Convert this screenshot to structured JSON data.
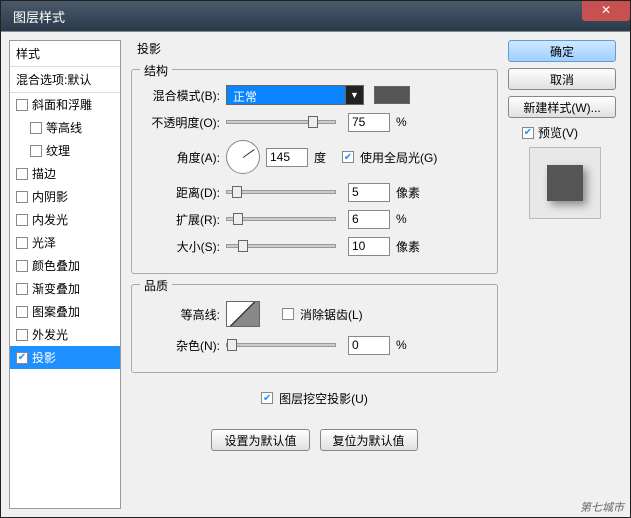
{
  "titlebar": {
    "title": "图层样式"
  },
  "left": {
    "headers": [
      "样式",
      "混合选项:默认"
    ],
    "items": [
      {
        "key": "bevel",
        "label": "斜面和浮雕",
        "checked": false,
        "indent": 0
      },
      {
        "key": "contour",
        "label": "等高线",
        "checked": false,
        "indent": 1
      },
      {
        "key": "texture",
        "label": "纹理",
        "checked": false,
        "indent": 1
      },
      {
        "key": "stroke",
        "label": "描边",
        "checked": false,
        "indent": 0
      },
      {
        "key": "innershadow",
        "label": "内阴影",
        "checked": false,
        "indent": 0
      },
      {
        "key": "innerglow",
        "label": "内发光",
        "checked": false,
        "indent": 0
      },
      {
        "key": "satin",
        "label": "光泽",
        "checked": false,
        "indent": 0
      },
      {
        "key": "coloroverlay",
        "label": "颜色叠加",
        "checked": false,
        "indent": 0
      },
      {
        "key": "gradientoverlay",
        "label": "渐变叠加",
        "checked": false,
        "indent": 0
      },
      {
        "key": "patternoverlay",
        "label": "图案叠加",
        "checked": false,
        "indent": 0
      },
      {
        "key": "outerglow",
        "label": "外发光",
        "checked": false,
        "indent": 0
      },
      {
        "key": "dropshadow",
        "label": "投影",
        "checked": true,
        "indent": 0,
        "selected": true
      }
    ]
  },
  "section_title": "投影",
  "structure": {
    "legend": "结构",
    "blend_label": "混合模式(B):",
    "blend_value": "正常",
    "opacity_label": "不透明度(O):",
    "opacity_value": "75",
    "angle_label": "角度(A):",
    "angle_value": "145",
    "angle_unit": "度",
    "global_label": "使用全局光(G)",
    "global_checked": true,
    "distance_label": "距离(D):",
    "distance_value": "5",
    "distance_unit": "像素",
    "spread_label": "扩展(R):",
    "spread_value": "6",
    "size_label": "大小(S):",
    "size_value": "10",
    "size_unit": "像素",
    "pct": "%"
  },
  "quality": {
    "legend": "品质",
    "contour_label": "等高线:",
    "antialias_label": "消除锯齿(L)",
    "antialias_checked": false,
    "noise_label": "杂色(N):",
    "noise_value": "0",
    "pct": "%"
  },
  "knockout": {
    "label": "图层挖空投影(U)",
    "checked": true
  },
  "actions": {
    "default_btn": "设置为默认值",
    "reset_btn": "复位为默认值"
  },
  "right": {
    "ok": "确定",
    "cancel": "取消",
    "newstyle": "新建样式(W)...",
    "preview_label": "预览(V)",
    "preview_checked": true
  },
  "watermark": "第七城市"
}
